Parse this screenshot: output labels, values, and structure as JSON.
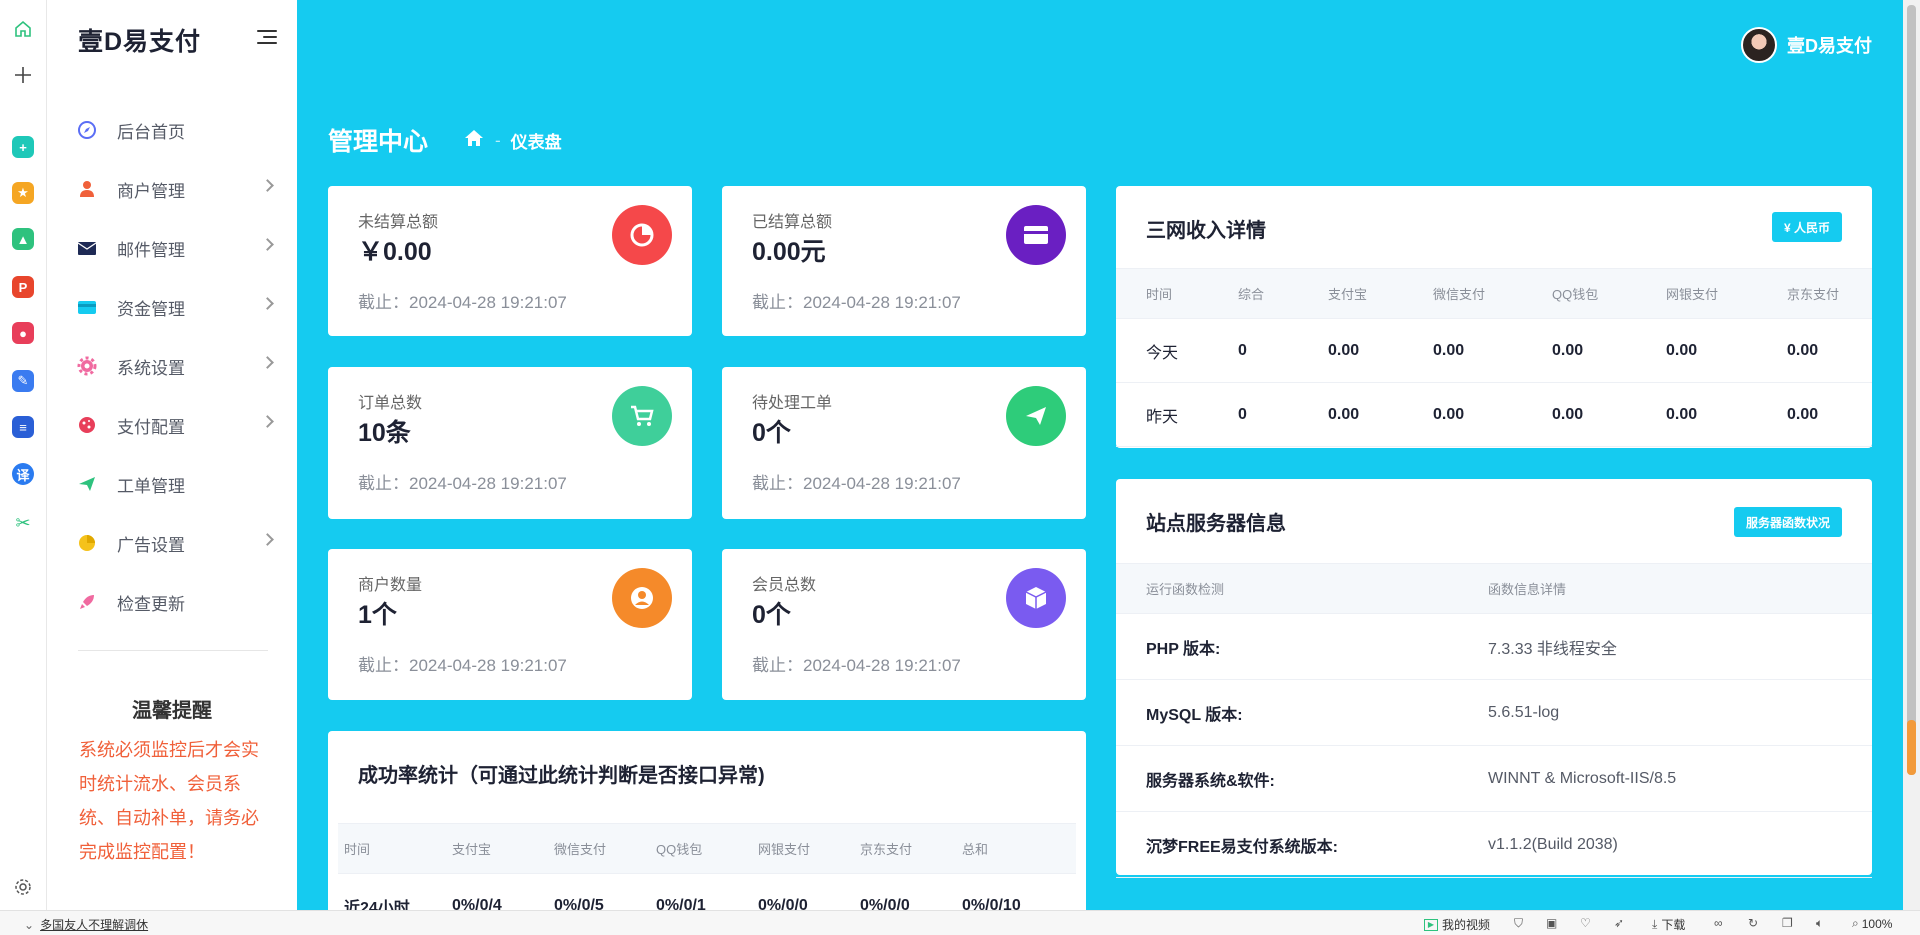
{
  "sidebar": {
    "brand": "壹D易支付",
    "items": [
      {
        "label": "后台首页",
        "icon": "compass-icon",
        "color": "#5b6ef5"
      },
      {
        "label": "商户管理",
        "icon": "user-icon",
        "color": "#f0603a"
      },
      {
        "label": "邮件管理",
        "icon": "envelope-icon",
        "color": "#1e2a55"
      },
      {
        "label": "资金管理",
        "icon": "credit-card-icon",
        "color": "#15cbf0"
      },
      {
        "label": "系统设置",
        "icon": "gear-icon",
        "color": "#f06aa0"
      },
      {
        "label": "支付配置",
        "icon": "cookie-icon",
        "color": "#e83e5a"
      },
      {
        "label": "工单管理",
        "icon": "paper-plane-icon",
        "color": "#2ec27e"
      },
      {
        "label": "广告设置",
        "icon": "pie-chart-icon",
        "color": "#f5c21b"
      },
      {
        "label": "检查更新",
        "icon": "rocket-icon",
        "color": "#f06aa0"
      }
    ],
    "tip": {
      "title": "温馨提醒",
      "body": "系统必须监控后才会实时统计流水、会员系统、自动补单，请务必完成监控配置！"
    }
  },
  "header": {
    "user_name": "壹D易支付",
    "page_title": "管理中心",
    "breadcrumb_current": "仪表盘",
    "breadcrumb_sep": "-"
  },
  "stats": [
    {
      "label": "未结算总额",
      "value": "￥0.00",
      "date": "截止：2024-04-28 19:21:07",
      "icon": "pie-chart-icon",
      "color": "#f5484a"
    },
    {
      "label": "已结算总额",
      "value": "0.00元",
      "date": "截止：2024-04-28 19:21:07",
      "icon": "credit-card-icon",
      "color": "#6a1fc2"
    },
    {
      "label": "订单总数",
      "value": "10条",
      "date": "截止：2024-04-28 19:21:07",
      "icon": "cart-icon",
      "color": "#3fcf9a"
    },
    {
      "label": "待处理工单",
      "value": "0个",
      "date": "截止：2024-04-28 19:21:07",
      "icon": "paper-plane-icon",
      "color": "#2ecc7a"
    },
    {
      "label": "商户数量",
      "value": "1个",
      "date": "截止：2024-04-28 19:21:07",
      "icon": "user-circle-icon",
      "color": "#f58a2a"
    },
    {
      "label": "会员总数",
      "value": "0个",
      "date": "截止：2024-04-28 19:21:07",
      "icon": "cube-icon",
      "color": "#7a5bf0"
    }
  ],
  "income": {
    "title": "三网收入详情",
    "button": "¥ 人民币",
    "columns": [
      "时间",
      "综合",
      "支付宝",
      "微信支付",
      "QQ钱包",
      "网银支付",
      "京东支付"
    ],
    "rows": [
      [
        "今天",
        "0",
        "0.00",
        "0.00",
        "0.00",
        "0.00",
        "0.00"
      ],
      [
        "昨天",
        "0",
        "0.00",
        "0.00",
        "0.00",
        "0.00",
        "0.00"
      ]
    ]
  },
  "server": {
    "title": "站点服务器信息",
    "button": "服务器函数状况",
    "columns": [
      "运行函数检测",
      "函数信息详情"
    ],
    "rows": [
      [
        "PHP 版本:",
        "7.3.33 非线程安全"
      ],
      [
        "MySQL 版本:",
        "5.6.51-log"
      ],
      [
        "服务器系统&软件:",
        "WINNT & Microsoft-IIS/8.5"
      ],
      [
        "沉梦FREE易支付系统版本:",
        "v1.1.2(Build 2038)"
      ]
    ]
  },
  "success": {
    "title": "成功率统计（可通过此统计判断是否接口异常)",
    "columns": [
      "时间",
      "支付宝",
      "微信支付",
      "QQ钱包",
      "网银支付",
      "京东支付",
      "总和"
    ],
    "rows": [
      [
        "近24小时",
        "0%/0/4",
        "0%/0/5",
        "0%/0/1",
        "0%/0/0",
        "0%/0/0",
        "0%/0/10"
      ]
    ]
  },
  "statusbar": {
    "left_text": "多国友人不理解调休",
    "video": "我的视频",
    "download": "下载",
    "zoom": "100%"
  }
}
